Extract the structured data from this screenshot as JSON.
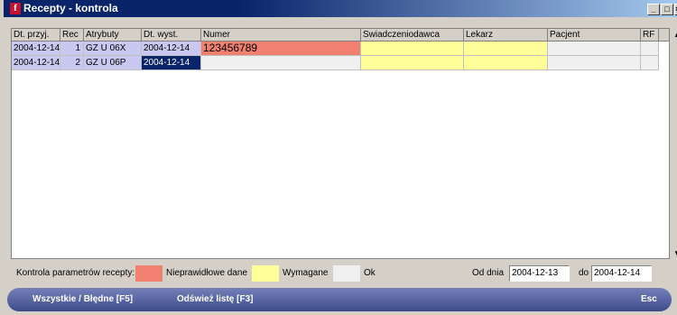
{
  "window": {
    "title": "Recepty - kontrola",
    "icon": "f"
  },
  "title_buttons": {
    "minimize": "_",
    "maximize": "□",
    "close": "×"
  },
  "columns": [
    "Dt. przyj.",
    "Rec",
    "Atrybuty",
    "Dt. wyst.",
    "Numer",
    "Swiadczeniodawca",
    "Lekarz",
    "Pacjent",
    "RF"
  ],
  "rows": [
    {
      "dt_przyj": "2004-12-14",
      "rec": "1",
      "atrybuty": "GZ U 06X",
      "dt_wyst": "2004-12-14",
      "numer": "123456789",
      "swiadczeniodawca": "",
      "lekarz": "",
      "pacjent": "",
      "rf": ""
    },
    {
      "dt_przyj": "2004-12-14",
      "rec": "2",
      "atrybuty": "GZ U 06P",
      "dt_wyst": "2004-12-14",
      "numer": "",
      "swiadczeniodawca": "",
      "lekarz": "",
      "pacjent": "",
      "rf": ""
    }
  ],
  "legend": {
    "label": "Kontrola parametrów recepty:",
    "invalid_label": "Nieprawidłowe dane",
    "required_label": "Wymagane",
    "ok_label": "Ok",
    "invalid_color": "#f08070",
    "required_color": "#ffff99",
    "ok_color": "#f0f0f0"
  },
  "date_filter": {
    "from_label": "Od dnia",
    "from_value": "2004-12-13",
    "to_label": "do",
    "to_value": "2004-12-14"
  },
  "toolbar": {
    "toggle_label": "Wszystkie / Błędne [F5]",
    "refresh_label": "Odśwież listę [F3]",
    "esc_label": "Esc"
  }
}
